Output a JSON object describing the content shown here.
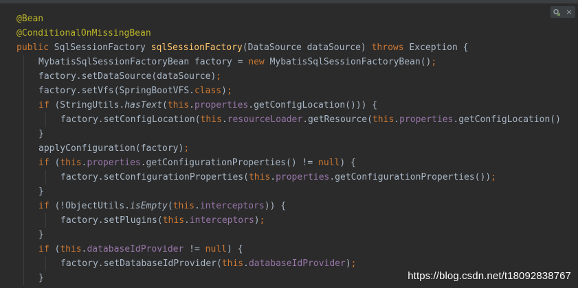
{
  "colors": {
    "background": "#2b2b2b",
    "annotation": "#bbb529",
    "keyword": "#cc7832",
    "plain": "#a9b7c6",
    "method_decl": "#ffc66d",
    "field": "#9876aa",
    "static_italic": "#a9b7c6"
  },
  "editor": {
    "lines": [
      {
        "indent": 0,
        "tokens": [
          {
            "t": "@Bean",
            "c": "annotation"
          }
        ]
      },
      {
        "indent": 0,
        "tokens": [
          {
            "t": "@ConditionalOnMissingBean",
            "c": "annotation"
          }
        ]
      },
      {
        "indent": 0,
        "tokens": [
          {
            "t": "public ",
            "c": "keyword"
          },
          {
            "t": "SqlSessionFactory ",
            "c": "plain"
          },
          {
            "t": "sqlSessionFactory",
            "c": "method_decl"
          },
          {
            "t": "(DataSource dataSource) ",
            "c": "plain"
          },
          {
            "t": "throws ",
            "c": "keyword"
          },
          {
            "t": "Exception {",
            "c": "plain"
          }
        ]
      },
      {
        "indent": 1,
        "tokens": [
          {
            "t": "MybatisSqlSessionFactoryBean factory = ",
            "c": "plain"
          },
          {
            "t": "new ",
            "c": "keyword"
          },
          {
            "t": "MybatisSqlSessionFactoryBean()",
            "c": "plain"
          },
          {
            "t": ";",
            "c": "keyword"
          }
        ]
      },
      {
        "indent": 1,
        "tokens": [
          {
            "t": "factory.setDataSource(dataSource)",
            "c": "plain"
          },
          {
            "t": ";",
            "c": "keyword"
          }
        ]
      },
      {
        "indent": 1,
        "tokens": [
          {
            "t": "factory.setVfs(SpringBootVFS.",
            "c": "plain"
          },
          {
            "t": "class",
            "c": "keyword"
          },
          {
            "t": ")",
            "c": "plain"
          },
          {
            "t": ";",
            "c": "keyword"
          }
        ]
      },
      {
        "indent": 1,
        "tokens": [
          {
            "t": "if ",
            "c": "keyword"
          },
          {
            "t": "(StringUtils.",
            "c": "plain"
          },
          {
            "t": "hasText",
            "c": "italic"
          },
          {
            "t": "(",
            "c": "plain"
          },
          {
            "t": "this",
            "c": "keyword"
          },
          {
            "t": ".",
            "c": "plain"
          },
          {
            "t": "properties",
            "c": "field"
          },
          {
            "t": ".getConfigLocation())) {",
            "c": "plain"
          }
        ]
      },
      {
        "indent": 2,
        "tokens": [
          {
            "t": "factory.setConfigLocation(",
            "c": "plain"
          },
          {
            "t": "this",
            "c": "keyword"
          },
          {
            "t": ".",
            "c": "plain"
          },
          {
            "t": "resourceLoader",
            "c": "field"
          },
          {
            "t": ".getResource(",
            "c": "plain"
          },
          {
            "t": "this",
            "c": "keyword"
          },
          {
            "t": ".",
            "c": "plain"
          },
          {
            "t": "properties",
            "c": "field"
          },
          {
            "t": ".getConfigLocation()",
            "c": "plain"
          }
        ]
      },
      {
        "indent": 1,
        "tokens": [
          {
            "t": "}",
            "c": "plain"
          }
        ]
      },
      {
        "indent": 1,
        "tokens": [
          {
            "t": "applyConfiguration(factory)",
            "c": "plain"
          },
          {
            "t": ";",
            "c": "keyword"
          }
        ]
      },
      {
        "indent": 1,
        "tokens": [
          {
            "t": "if ",
            "c": "keyword"
          },
          {
            "t": "(",
            "c": "plain"
          },
          {
            "t": "this",
            "c": "keyword"
          },
          {
            "t": ".",
            "c": "plain"
          },
          {
            "t": "properties",
            "c": "field"
          },
          {
            "t": ".getConfigurationProperties() != ",
            "c": "plain"
          },
          {
            "t": "null",
            "c": "keyword"
          },
          {
            "t": ") {",
            "c": "plain"
          }
        ]
      },
      {
        "indent": 2,
        "tokens": [
          {
            "t": "factory.setConfigurationProperties(",
            "c": "plain"
          },
          {
            "t": "this",
            "c": "keyword"
          },
          {
            "t": ".",
            "c": "plain"
          },
          {
            "t": "properties",
            "c": "field"
          },
          {
            "t": ".getConfigurationProperties())",
            "c": "plain"
          },
          {
            "t": ";",
            "c": "keyword"
          }
        ]
      },
      {
        "indent": 1,
        "tokens": [
          {
            "t": "}",
            "c": "plain"
          }
        ]
      },
      {
        "indent": 1,
        "tokens": [
          {
            "t": "if ",
            "c": "keyword"
          },
          {
            "t": "(!ObjectUtils.",
            "c": "plain"
          },
          {
            "t": "isEmpty",
            "c": "italic"
          },
          {
            "t": "(",
            "c": "plain"
          },
          {
            "t": "this",
            "c": "keyword"
          },
          {
            "t": ".",
            "c": "plain"
          },
          {
            "t": "interceptors",
            "c": "field"
          },
          {
            "t": ")) {",
            "c": "plain"
          }
        ]
      },
      {
        "indent": 2,
        "tokens": [
          {
            "t": "factory.setPlugins(",
            "c": "plain"
          },
          {
            "t": "this",
            "c": "keyword"
          },
          {
            "t": ".",
            "c": "plain"
          },
          {
            "t": "interceptors",
            "c": "field"
          },
          {
            "t": ")",
            "c": "plain"
          },
          {
            "t": ";",
            "c": "keyword"
          }
        ]
      },
      {
        "indent": 1,
        "tokens": [
          {
            "t": "}",
            "c": "plain"
          }
        ]
      },
      {
        "indent": 1,
        "tokens": [
          {
            "t": "if ",
            "c": "keyword"
          },
          {
            "t": "(",
            "c": "plain"
          },
          {
            "t": "this",
            "c": "keyword"
          },
          {
            "t": ".",
            "c": "plain"
          },
          {
            "t": "databaseIdProvider",
            "c": "field"
          },
          {
            "t": " != ",
            "c": "plain"
          },
          {
            "t": "null",
            "c": "keyword"
          },
          {
            "t": ") {",
            "c": "plain"
          }
        ]
      },
      {
        "indent": 2,
        "tokens": [
          {
            "t": "factory.setDatabaseIdProvider(",
            "c": "plain"
          },
          {
            "t": "this",
            "c": "keyword"
          },
          {
            "t": ".",
            "c": "plain"
          },
          {
            "t": "databaseIdProvider",
            "c": "field"
          },
          {
            "t": ")",
            "c": "plain"
          },
          {
            "t": ";",
            "c": "keyword"
          }
        ]
      },
      {
        "indent": 1,
        "tokens": [
          {
            "t": "}",
            "c": "plain"
          }
        ]
      }
    ]
  },
  "widget": {
    "icons": [
      "inspection-icon",
      "close-icon"
    ],
    "close_glyph": "×"
  },
  "watermark": {
    "text": "https://blog.csdn.net/t18092838767"
  }
}
